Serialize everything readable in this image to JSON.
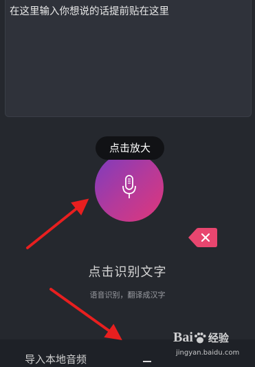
{
  "text_input": {
    "placeholder": "在这里输入你想说的话提前贴在这里",
    "value": ""
  },
  "tooltip": {
    "label": "点击放大"
  },
  "mic_button": {
    "icon": "microphone-icon",
    "gradient_start": "#7a3cc0",
    "gradient_end": "#e0377a"
  },
  "clear_button": {
    "icon": "close-icon",
    "color": "#e8466f"
  },
  "recognition": {
    "label": "点击识别文字",
    "sublabel": "语音识别，翻译成汉字"
  },
  "bottom_bar": {
    "import_label": "导入本地音频"
  },
  "annotations": {
    "arrow_color": "#e81f1f"
  },
  "watermark": {
    "logo_text": "Bai",
    "logo_text2": "经验",
    "url": "jingyan.baidu.com"
  },
  "colors": {
    "background": "#25282e",
    "input_background": "#2f323a",
    "bottom_bar": "#1e2127"
  }
}
